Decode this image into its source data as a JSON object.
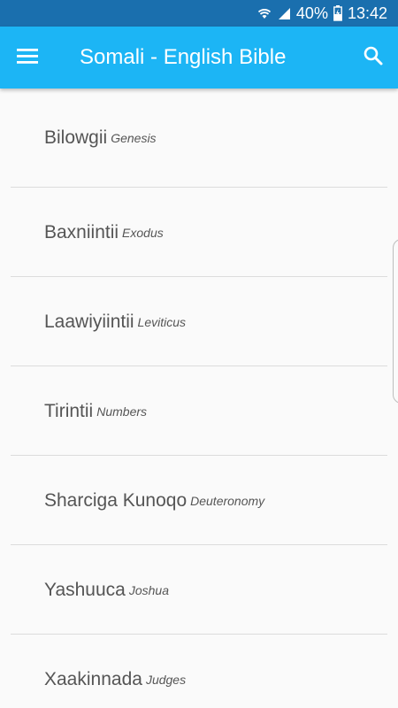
{
  "status_bar": {
    "battery": "40%",
    "time": "13:42",
    "icons": [
      "wifi-icon",
      "signal-icon",
      "battery-icon"
    ]
  },
  "app_bar": {
    "title": "Somali - English Bible",
    "menu_icon": "menu-icon",
    "search_icon": "search-icon"
  },
  "books": [
    {
      "somali": "Bilowgii",
      "english": "Genesis"
    },
    {
      "somali": "Baxniintii",
      "english": "Exodus"
    },
    {
      "somali": "Laawiyiintii",
      "english": "Leviticus"
    },
    {
      "somali": "Tirintii",
      "english": "Numbers"
    },
    {
      "somali": "Sharciga Kunoqo",
      "english": "Deuteronomy"
    },
    {
      "somali": "Yashuuca",
      "english": "Joshua"
    },
    {
      "somali": "Xaakinnada",
      "english": "Judges"
    }
  ],
  "colors": {
    "status_bar": "#1a6fae",
    "app_bar": "#1cb5f5",
    "background": "#fafafa"
  }
}
